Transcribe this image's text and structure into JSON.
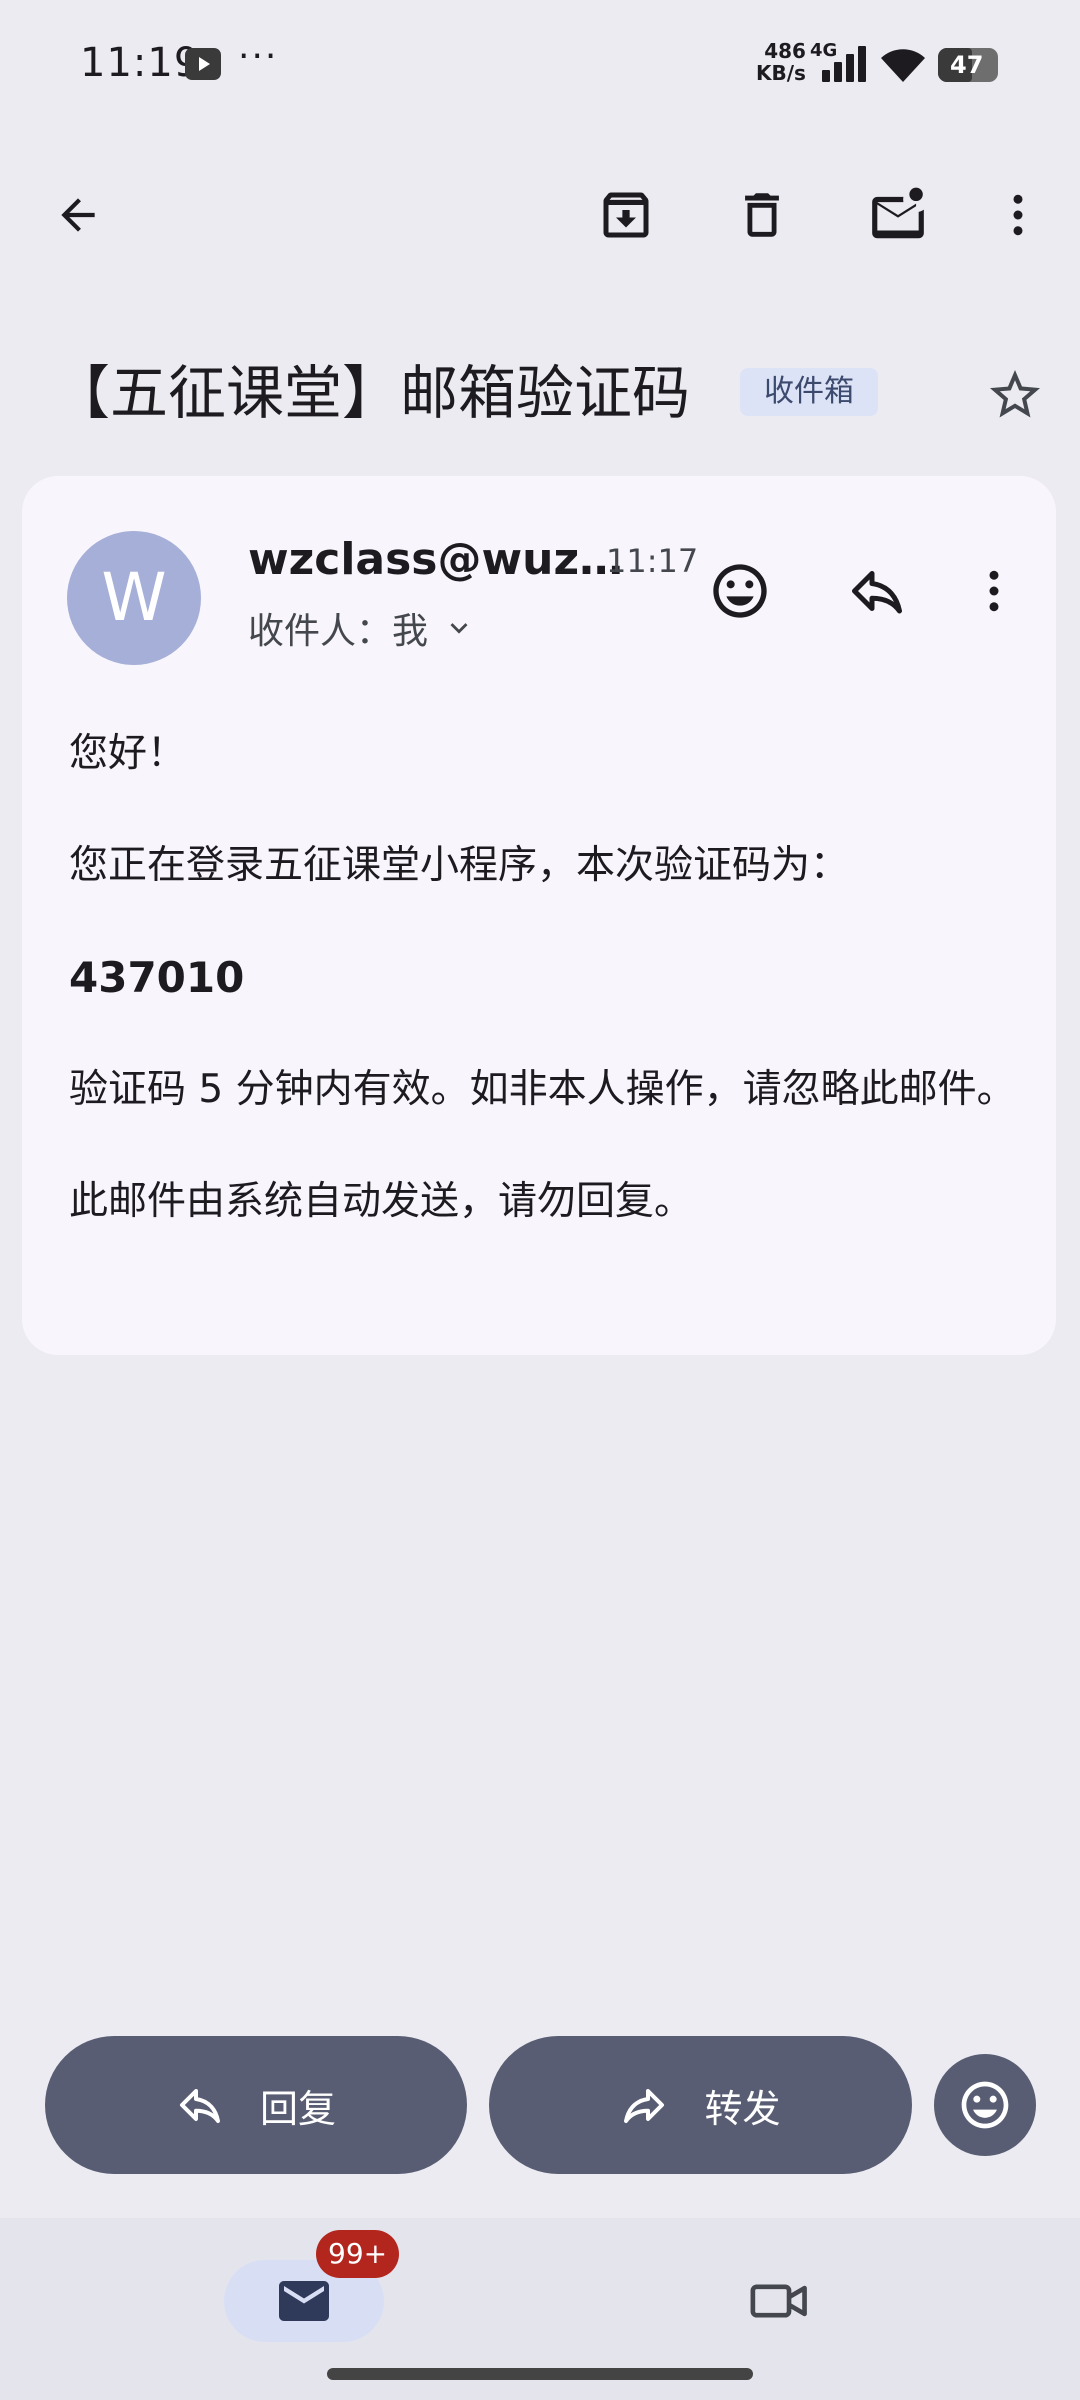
{
  "status_bar": {
    "time": "11:19",
    "more": "···",
    "net_speed_value": "486",
    "net_speed_unit": "KB/s",
    "network": "4G",
    "battery": "47"
  },
  "toolbar": {
    "back_icon": "arrow-left-icon",
    "archive_icon": "archive-icon",
    "delete_icon": "trash-icon",
    "unread_icon": "mark-unread-icon",
    "more_icon": "more-vert-icon"
  },
  "email": {
    "subject": "【五征课堂】邮箱验证码",
    "label": "收件箱",
    "sender_initial": "W",
    "sender": "wzclass@wuz…",
    "time": "11:17",
    "recipients": "收件人：我",
    "body": {
      "greeting": "您好！",
      "line1": "您正在登录五征课堂小程序，本次验证码为：",
      "code": "437010",
      "line2": "验证码 5 分钟内有效。如非本人操作，请忽略此邮件。",
      "line3": "此邮件由系统自动发送，请勿回复。"
    }
  },
  "actions": {
    "reply": "回复",
    "forward": "转发"
  },
  "bottom_nav": {
    "mail_badge": "99+"
  },
  "colors": {
    "background": "#ECEBF1",
    "card": "#F8F6FC",
    "action_button": "#585D73",
    "avatar": "#A6AFD8",
    "badge": "#B3261E",
    "label_chip": "#DCE3F7"
  }
}
